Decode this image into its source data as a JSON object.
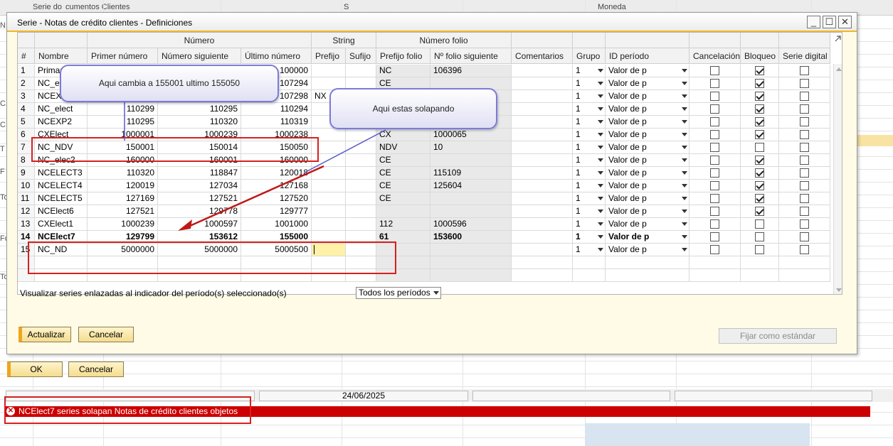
{
  "background": {
    "header_fragments": [
      "Serie do",
      "cumentos Clientes",
      "S",
      "Moneda"
    ],
    "left_fragments": [
      "N",
      "C",
      "C",
      "T",
      "F",
      "To",
      "Fo",
      "To"
    ]
  },
  "dialog": {
    "title": "Serie - Notas de crédito clientes - Definiciones",
    "minimize": "_",
    "maximize": "☐",
    "close": "✕",
    "groups": {
      "numero": "Número",
      "string": "String",
      "numero_folio": "Número folio"
    },
    "columns": [
      "#",
      "Nombre",
      "Primer número",
      "Número siguiente",
      "Último número",
      "Prefijo",
      "Sufijo",
      "Prefijo folio",
      "Nº folio siguiente",
      "Comentarios",
      "Grupo",
      "ID período",
      "Cancelación",
      "Bloqueo",
      "Serie digital"
    ],
    "rows": [
      {
        "n": "1",
        "nombre": "Primar",
        "primer": "",
        "siguiente": "",
        "ultimo": "100000",
        "prefijo": "",
        "sufijo": "",
        "pfolio": "NC",
        "nfolio": "106396",
        "grupo": "1",
        "periodo": "Valor de p",
        "cancel": false,
        "bloqueo": true,
        "digital": false
      },
      {
        "n": "2",
        "nombre": "NC_el",
        "primer": "",
        "siguiente": "",
        "ultimo": "107294",
        "prefijo": "",
        "sufijo": "",
        "pfolio": "CE",
        "nfolio": "",
        "grupo": "1",
        "periodo": "Valor de p",
        "cancel": false,
        "bloqueo": true,
        "digital": false
      },
      {
        "n": "3",
        "nombre": "NCEXP",
        "primer": "",
        "siguiente": "",
        "ultimo": "107298",
        "prefijo": "NX",
        "sufijo": "",
        "pfolio": "",
        "nfolio": "",
        "grupo": "1",
        "periodo": "Valor de p",
        "cancel": false,
        "bloqueo": true,
        "digital": false
      },
      {
        "n": "4",
        "nombre": "NC_elect",
        "primer": "110299",
        "siguiente": "110295",
        "ultimo": "110294",
        "prefijo": "",
        "sufijo": "",
        "pfolio": "",
        "nfolio": "",
        "grupo": "1",
        "periodo": "Valor de p",
        "cancel": false,
        "bloqueo": true,
        "digital": false
      },
      {
        "n": "5",
        "nombre": "NCEXP2",
        "primer": "110295",
        "siguiente": "110320",
        "ultimo": "110319",
        "prefijo": "",
        "sufijo": "",
        "pfolio": "",
        "nfolio": "",
        "grupo": "1",
        "periodo": "Valor de p",
        "cancel": false,
        "bloqueo": true,
        "digital": false
      },
      {
        "n": "6",
        "nombre": "CXElect",
        "primer": "1000001",
        "siguiente": "1000239",
        "ultimo": "1000238",
        "prefijo": "",
        "sufijo": "",
        "pfolio": "CX",
        "nfolio": "1000065",
        "grupo": "1",
        "periodo": "Valor de p",
        "cancel": false,
        "bloqueo": true,
        "digital": false
      },
      {
        "n": "7",
        "nombre": "NC_NDV",
        "primer": "150001",
        "siguiente": "150014",
        "ultimo": "150050",
        "prefijo": "",
        "sufijo": "",
        "pfolio": "NDV",
        "nfolio": "10",
        "grupo": "1",
        "periodo": "Valor de p",
        "cancel": false,
        "bloqueo": false,
        "digital": false
      },
      {
        "n": "8",
        "nombre": "NC_elec2",
        "primer": "160000",
        "siguiente": "160001",
        "ultimo": "160000",
        "prefijo": "",
        "sufijo": "",
        "pfolio": "CE",
        "nfolio": "",
        "grupo": "1",
        "periodo": "Valor de p",
        "cancel": false,
        "bloqueo": true,
        "digital": false
      },
      {
        "n": "9",
        "nombre": "NCELECT3",
        "primer": "110320",
        "siguiente": "118847",
        "ultimo": "120018",
        "prefijo": "",
        "sufijo": "",
        "pfolio": "CE",
        "nfolio": "115109",
        "grupo": "1",
        "periodo": "Valor de p",
        "cancel": false,
        "bloqueo": true,
        "digital": false
      },
      {
        "n": "10",
        "nombre": "NCELECT4",
        "primer": "120019",
        "siguiente": "127034",
        "ultimo": "127168",
        "prefijo": "",
        "sufijo": "",
        "pfolio": "CE",
        "nfolio": "125604",
        "grupo": "1",
        "periodo": "Valor de p",
        "cancel": false,
        "bloqueo": true,
        "digital": false
      },
      {
        "n": "11",
        "nombre": "NCELECT5",
        "primer": "127169",
        "siguiente": "127521",
        "ultimo": "127520",
        "prefijo": "",
        "sufijo": "",
        "pfolio": "CE",
        "nfolio": "",
        "grupo": "1",
        "periodo": "Valor de p",
        "cancel": false,
        "bloqueo": true,
        "digital": false
      },
      {
        "n": "12",
        "nombre": "NCElect6",
        "primer": "127521",
        "siguiente": "129778",
        "ultimo": "129777",
        "prefijo": "",
        "sufijo": "",
        "pfolio": "",
        "nfolio": "",
        "grupo": "1",
        "periodo": "Valor de p",
        "cancel": false,
        "bloqueo": true,
        "digital": false
      },
      {
        "n": "13",
        "nombre": "CXElect1",
        "primer": "1000239",
        "siguiente": "1000597",
        "ultimo": "1001000",
        "prefijo": "",
        "sufijo": "",
        "pfolio": "112",
        "nfolio": "1000596",
        "grupo": "1",
        "periodo": "Valor de p",
        "cancel": false,
        "bloqueo": false,
        "digital": false
      },
      {
        "n": "14",
        "nombre": "NCElect7",
        "primer": "129799",
        "siguiente": "153612",
        "ultimo": "155000",
        "prefijo": "",
        "sufijo": "",
        "pfolio": "61",
        "nfolio": "153600",
        "grupo": "1",
        "periodo": "Valor de p",
        "cancel": false,
        "bloqueo": false,
        "digital": false,
        "bold": true
      },
      {
        "n": "15",
        "nombre": "NC_ND",
        "primer": "5000000",
        "siguiente": "5000000",
        "ultimo": "5000500",
        "prefijo": "",
        "sufijo": "",
        "pfolio": "",
        "nfolio": "",
        "grupo": "1",
        "periodo": "Valor de p",
        "cancel": false,
        "bloqueo": false,
        "digital": false
      }
    ],
    "visualizar_label": "Visualizar series enlazadas al indicador del período(s) seleccionado(s)",
    "period_filter": "Todos los períodos",
    "actualizar": "Actualizar",
    "cancelar": "Cancelar",
    "fijar": "Fijar como estándar"
  },
  "outer": {
    "ok": "OK",
    "cancelar": "Cancelar"
  },
  "status": {
    "date": "24/06/2025",
    "error": "NCElect7 series solapan Notas de crédito clientes objetos"
  },
  "annotations": {
    "callout1": "Aqui cambia a 155001 ultimo 155050",
    "callout2": "Aqui estas solapando"
  },
  "colors": {
    "accent": "#f4b623",
    "error": "#cc0000",
    "annotation": "#d62020",
    "callout_border": "#7d7bd6"
  }
}
